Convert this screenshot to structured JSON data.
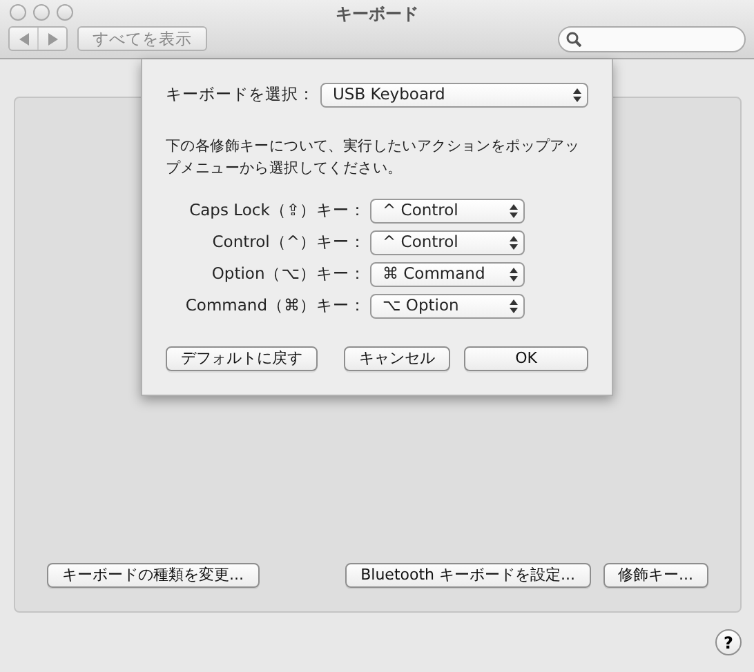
{
  "window": {
    "title": "キーボード"
  },
  "toolbar": {
    "show_all": "すべてを表示"
  },
  "sheet": {
    "keyboard_label": "キーボードを選択：",
    "keyboard_value": "USB Keyboard",
    "instructions": "下の各修飾キーについて、実行したいアクションをポップアップメニューから選択してください。",
    "modifiers": [
      {
        "label": "Caps Lock（⇪）キー：",
        "value": "^ Control"
      },
      {
        "label": "Control（^）キー：",
        "value": "^ Control"
      },
      {
        "label": "Option（⌥）キー：",
        "value": "⌘ Command"
      },
      {
        "label": "Command（⌘）キー：",
        "value": "⌥ Option"
      }
    ],
    "buttons": [
      {
        "label": "デフォルトに戻す",
        "kind": "left"
      },
      {
        "label": "キャンセル",
        "kind": "right"
      },
      {
        "label": "OK",
        "kind": "right"
      }
    ]
  },
  "bottom_buttons": [
    {
      "label": "キーボードの種類を変更...",
      "kind": "left"
    },
    {
      "label": "Bluetooth キーボードを設定...",
      "kind": "right"
    },
    {
      "label": "修飾キー...",
      "kind": "right"
    }
  ],
  "help": "?"
}
